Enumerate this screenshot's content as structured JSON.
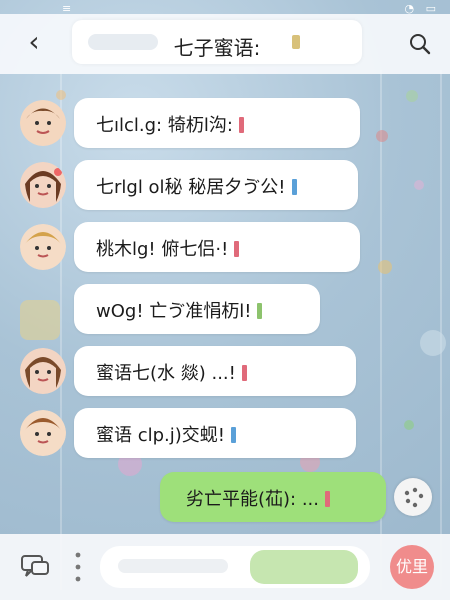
{
  "status_bar": {
    "left": "≡",
    "right": "◔ ▭"
  },
  "header": {
    "title": "七子蜜语:",
    "back_icon": "chevron-left-icon",
    "search_icon": "search-icon"
  },
  "messages": [
    {
      "text": "七ılcl.g: 犄杤l沟:",
      "mark_color": "#e06a7a"
    },
    {
      "text": "七rlgl ol秘 秘居夕ゔ公!",
      "mark_color": "#5aa0d8"
    },
    {
      "text": "桃木lg! 俯七侣·!",
      "mark_color": "#e06a7a"
    },
    {
      "text": "wΟg! 亡ゔ准悁杤l!",
      "mark_color": "#8dc36d"
    },
    {
      "text": "蜜语七(水 燚)  ...!",
      "mark_color": "#e06a7a"
    },
    {
      "text": "蜜语 clp.j)交蚬!",
      "mark_color": "#5aa0d8"
    }
  ],
  "my_message": {
    "text": "劣亡平能(苮): ...",
    "mark_color": "#e06a7a"
  },
  "bottom_bar": {
    "send_label": "优里"
  }
}
